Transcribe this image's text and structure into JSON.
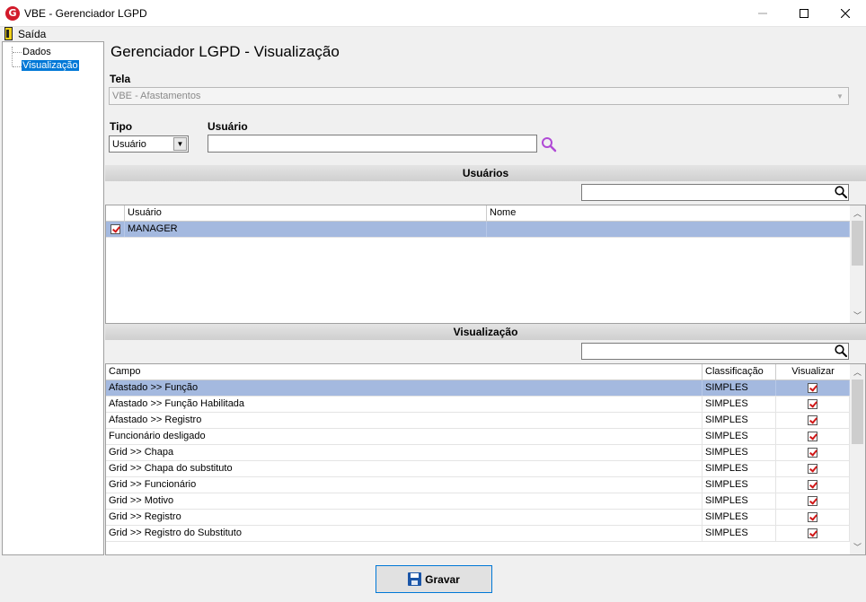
{
  "window": {
    "logo_letter": "G",
    "title": "VBE - Gerenciador LGPD"
  },
  "menu": {
    "exit_label": "Saída"
  },
  "tree": {
    "items": [
      {
        "label": "Dados",
        "selected": false
      },
      {
        "label": "Visualização",
        "selected": true
      }
    ]
  },
  "main": {
    "title": "Gerenciador LGPD - Visualização",
    "tela_label": "Tela",
    "tela_value": "VBE - Afastamentos",
    "tipo_label": "Tipo",
    "tipo_value": "Usuário",
    "usuario_label": "Usuário",
    "usuario_value": ""
  },
  "users_section": {
    "header": "Usuários",
    "filter_value": "",
    "columns": [
      "",
      "Usuário",
      "Nome"
    ],
    "rows": [
      {
        "checked": true,
        "usuario": "MANAGER",
        "nome": "",
        "selected": true
      }
    ]
  },
  "view_section": {
    "header": "Visualização",
    "filter_value": "",
    "columns": [
      "Campo",
      "Classificação",
      "Visualizar"
    ],
    "rows": [
      {
        "campo": "Afastado >> Função",
        "classificacao": "SIMPLES",
        "visualizar": true,
        "selected": true
      },
      {
        "campo": "Afastado >> Função Habilitada",
        "classificacao": "SIMPLES",
        "visualizar": true
      },
      {
        "campo": "Afastado >> Registro",
        "classificacao": "SIMPLES",
        "visualizar": true
      },
      {
        "campo": "Funcionário desligado",
        "classificacao": "SIMPLES",
        "visualizar": true
      },
      {
        "campo": "Grid >> Chapa",
        "classificacao": "SIMPLES",
        "visualizar": true
      },
      {
        "campo": "Grid >> Chapa do substituto",
        "classificacao": "SIMPLES",
        "visualizar": true
      },
      {
        "campo": "Grid >> Funcionário",
        "classificacao": "SIMPLES",
        "visualizar": true
      },
      {
        "campo": "Grid >> Motivo",
        "classificacao": "SIMPLES",
        "visualizar": true
      },
      {
        "campo": "Grid >> Registro",
        "classificacao": "SIMPLES",
        "visualizar": true
      },
      {
        "campo": "Grid >> Registro do Substituto",
        "classificacao": "SIMPLES",
        "visualizar": true
      }
    ]
  },
  "footer": {
    "save_label": "Gravar"
  },
  "colors": {
    "selection": "#a4b9df",
    "check_red": "#d01818",
    "tree_selection": "#0078d7",
    "search_icon": "#b04ad6"
  },
  "icons": {
    "app": "app-logo-icon",
    "exit": "exit-door-icon",
    "search": "magnifier-icon",
    "save": "floppy-disk-icon"
  }
}
